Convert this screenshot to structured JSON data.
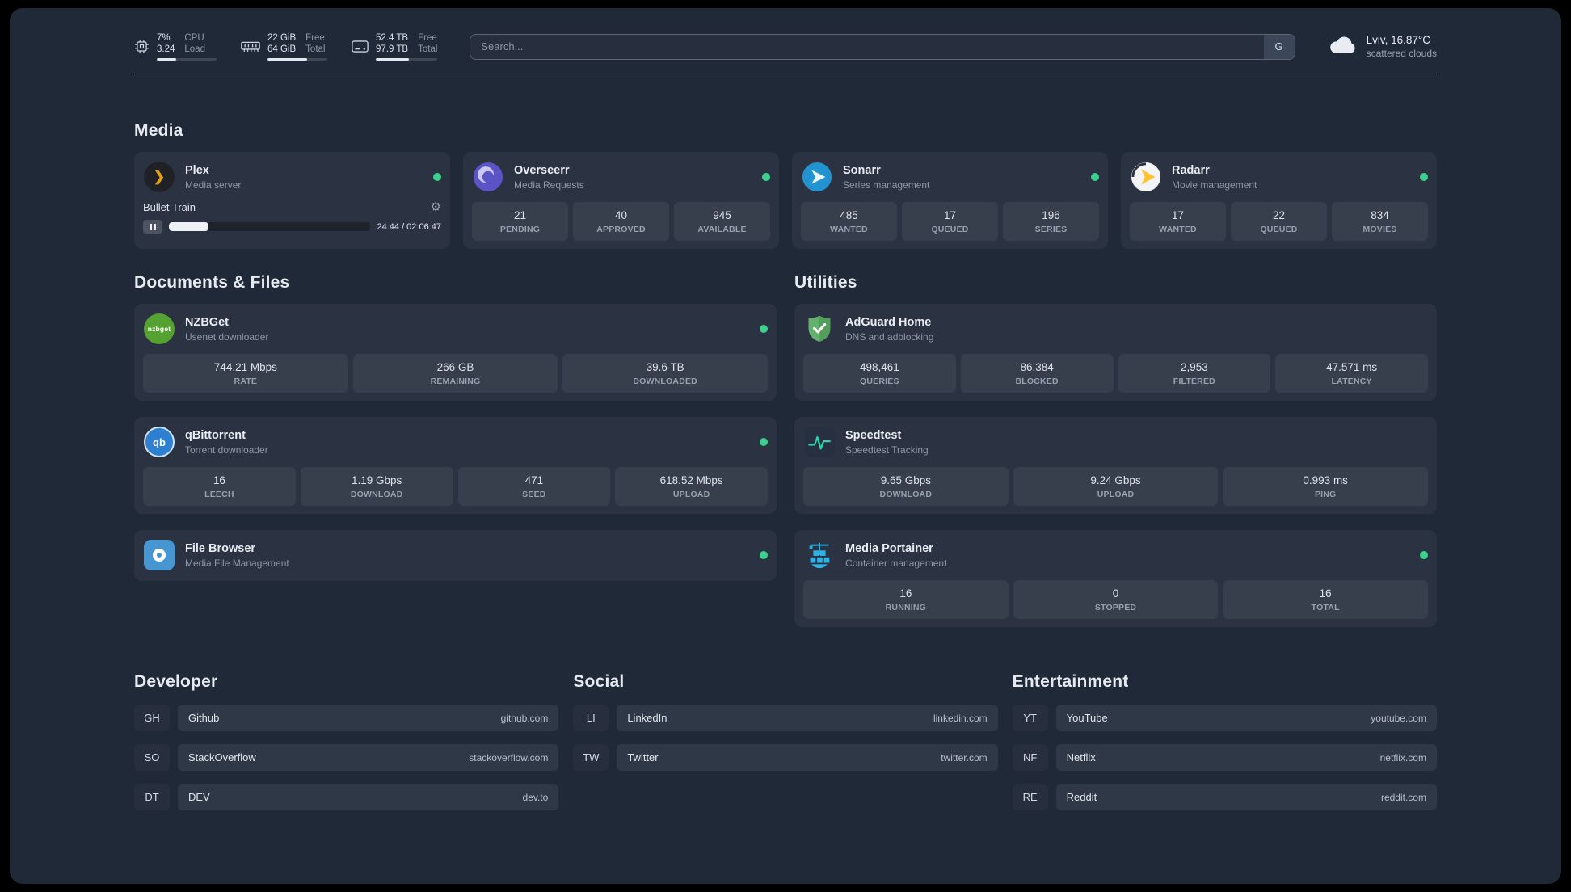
{
  "colors": {
    "background": "#202938",
    "card": "rgba(255,255,255,0.05)",
    "status_green": "#3ecf8e",
    "accent_plex": "#e5a00d",
    "accent_speedtest_line": "#2dd4a7"
  },
  "topbar": {
    "cpu": {
      "value_top": "7%",
      "value_bottom": "3.24",
      "label_top": "CPU",
      "label_bottom": "Load",
      "bar_percent": 33
    },
    "memory": {
      "value_top": "22 GiB",
      "value_bottom": "64 GiB",
      "label_top": "Free",
      "label_bottom": "Total",
      "bar_percent": 66
    },
    "disk": {
      "value_top": "52.4 TB",
      "value_bottom": "97.9 TB",
      "label_top": "Free",
      "label_bottom": "Total",
      "bar_percent": 54
    },
    "search": {
      "placeholder": "Search...",
      "provider_label": "G"
    },
    "weather": {
      "location": "Lviv, 16.87°C",
      "condition": "scattered clouds"
    }
  },
  "sections": {
    "media": {
      "title": "Media",
      "plex": {
        "name": "Plex",
        "desc": "Media server",
        "icon_glyph": "❯",
        "player": {
          "track": "Bullet Train",
          "time": "24:44 / 02:06:47",
          "progress_percent": 19.5,
          "gear_glyph": "⚙"
        }
      },
      "overseerr": {
        "name": "Overseerr",
        "desc": "Media Requests",
        "stats": [
          {
            "value": "21",
            "label": "PENDING"
          },
          {
            "value": "40",
            "label": "APPROVED"
          },
          {
            "value": "945",
            "label": "AVAILABLE"
          }
        ]
      },
      "sonarr": {
        "name": "Sonarr",
        "desc": "Series management",
        "stats": [
          {
            "value": "485",
            "label": "WANTED"
          },
          {
            "value": "17",
            "label": "QUEUED"
          },
          {
            "value": "196",
            "label": "SERIES"
          }
        ]
      },
      "radarr": {
        "name": "Radarr",
        "desc": "Movie management",
        "stats": [
          {
            "value": "17",
            "label": "WANTED"
          },
          {
            "value": "22",
            "label": "QUEUED"
          },
          {
            "value": "834",
            "label": "MOVIES"
          }
        ]
      }
    },
    "documents": {
      "title": "Documents & Files",
      "nzbget": {
        "name": "NZBGet",
        "desc": "Usenet downloader",
        "icon_text": "nzbget",
        "stats": [
          {
            "value": "744.21 Mbps",
            "label": "RATE"
          },
          {
            "value": "266 GB",
            "label": "REMAINING"
          },
          {
            "value": "39.6 TB",
            "label": "DOWNLOADED"
          }
        ]
      },
      "qbittorrent": {
        "name": "qBittorrent",
        "desc": "Torrent downloader",
        "icon_text": "qb",
        "stats": [
          {
            "value": "16",
            "label": "LEECH"
          },
          {
            "value": "1.19 Gbps",
            "label": "DOWNLOAD"
          },
          {
            "value": "471",
            "label": "SEED"
          },
          {
            "value": "618.52 Mbps",
            "label": "UPLOAD"
          }
        ]
      },
      "filebrowser": {
        "name": "File Browser",
        "desc": "Media File Management"
      }
    },
    "utilities": {
      "title": "Utilities",
      "adguard": {
        "name": "AdGuard Home",
        "desc": "DNS and adblocking",
        "stats": [
          {
            "value": "498,461",
            "label": "QUERIES"
          },
          {
            "value": "86,384",
            "label": "BLOCKED"
          },
          {
            "value": "2,953",
            "label": "FILTERED"
          },
          {
            "value": "47.571 ms",
            "label": "LATENCY"
          }
        ]
      },
      "speedtest": {
        "name": "Speedtest",
        "desc": "Speedtest Tracking",
        "stats": [
          {
            "value": "9.65 Gbps",
            "label": "DOWNLOAD"
          },
          {
            "value": "9.24 Gbps",
            "label": "UPLOAD"
          },
          {
            "value": "0.993 ms",
            "label": "PING"
          }
        ]
      },
      "portainer": {
        "name": "Media Portainer",
        "desc": "Container management",
        "stats": [
          {
            "value": "16",
            "label": "RUNNING"
          },
          {
            "value": "0",
            "label": "STOPPED"
          },
          {
            "value": "16",
            "label": "TOTAL"
          }
        ]
      }
    },
    "bookmarks": {
      "developer": {
        "title": "Developer",
        "items": [
          {
            "abbr": "GH",
            "name": "Github",
            "url": "github.com"
          },
          {
            "abbr": "SO",
            "name": "StackOverflow",
            "url": "stackoverflow.com"
          },
          {
            "abbr": "DT",
            "name": "DEV",
            "url": "dev.to"
          }
        ]
      },
      "social": {
        "title": "Social",
        "items": [
          {
            "abbr": "LI",
            "name": "LinkedIn",
            "url": "linkedin.com"
          },
          {
            "abbr": "TW",
            "name": "Twitter",
            "url": "twitter.com"
          }
        ]
      },
      "entertainment": {
        "title": "Entertainment",
        "items": [
          {
            "abbr": "YT",
            "name": "YouTube",
            "url": "youtube.com"
          },
          {
            "abbr": "NF",
            "name": "Netflix",
            "url": "netflix.com"
          },
          {
            "abbr": "RE",
            "name": "Reddit",
            "url": "reddit.com"
          }
        ]
      }
    }
  }
}
